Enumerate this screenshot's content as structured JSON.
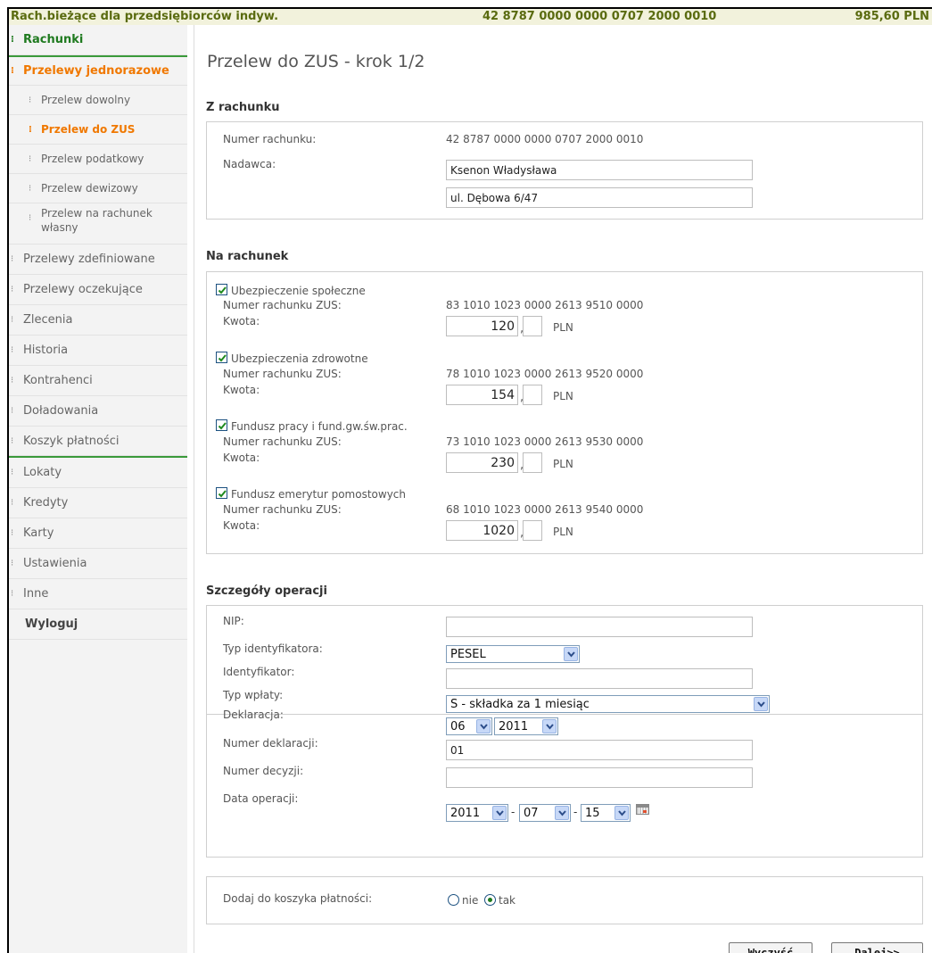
{
  "header": {
    "account_name": "Rach.bieżące dla przedsiębiorców indyw.",
    "account_number": "42 8787 0000 0000 0707 2000 0010",
    "balance": "985,60 PLN"
  },
  "sidebar": {
    "rachunki": "Rachunki",
    "przelewy_jednorazowe": "Przelewy jednorazowe",
    "sub_dowolny": "Przelew dowolny",
    "sub_zus": "Przelew do ZUS",
    "sub_podatkowy": "Przelew podatkowy",
    "sub_dewizowy": "Przelew dewizowy",
    "sub_wlasny": "Przelew na rachunek własny",
    "przelewy_zdefiniowane": "Przelewy zdefiniowane",
    "przelewy_oczekujace": "Przelewy oczekujące",
    "zlecenia": "Zlecenia",
    "historia": "Historia",
    "kontrahenci": "Kontrahenci",
    "doladowania": "Doładowania",
    "koszyk": "Koszyk płatności",
    "lokaty": "Lokaty",
    "kredyty": "Kredyty",
    "karty": "Karty",
    "ustawienia": "Ustawienia",
    "inne": "Inne",
    "wyloguj": "Wyloguj"
  },
  "page": {
    "title": "Przelew do ZUS - krok 1/2"
  },
  "z_rachunku": {
    "heading": "Z rachunku",
    "numer_label": "Numer rachunku:",
    "numer_value": "42 8787 0000 0000 0707 2000 0010",
    "nadawca_label": "Nadawca:",
    "nadawca_line1": "Ksenon Władysława",
    "nadawca_line2": "ul. Dębowa 6/47"
  },
  "na_rachunek": {
    "heading": "Na rachunek",
    "numer_label": "Numer rachunku ZUS:",
    "kwota_label": "Kwota:",
    "currency": "PLN",
    "items": [
      {
        "name": "Ubezpieczenie społeczne",
        "checked": true,
        "account": "83 1010 1023 0000 2613 9510 0000",
        "amount": "120",
        "grosze": ""
      },
      {
        "name": "Ubezpieczenia zdrowotne",
        "checked": true,
        "account": "78 1010 1023 0000 2613 9520 0000",
        "amount": "154",
        "grosze": ""
      },
      {
        "name": "Fundusz pracy i fund.gw.św.prac.",
        "checked": true,
        "account": "73 1010 1023 0000 2613 9530 0000",
        "amount": "230",
        "grosze": ""
      },
      {
        "name": "Fundusz emerytur pomostowych",
        "checked": true,
        "account": "68 1010 1023 0000 2613 9540 0000",
        "amount": "1020",
        "grosze": ""
      }
    ]
  },
  "szczegoly": {
    "heading": "Szczegóły operacji",
    "nip_label": "NIP:",
    "nip_value": "",
    "typ_id_label": "Typ identyfikatora:",
    "typ_id_value": "PESEL",
    "identyfikator_label": "Identyfikator:",
    "identyfikator_value": "",
    "typ_wplaty_label": "Typ wpłaty:",
    "typ_wplaty_value": "S - składka za 1 miesiąc",
    "deklaracja_label": "Deklaracja:",
    "deklaracja_month": "06",
    "deklaracja_year": "2011",
    "nr_deklaracji_label": "Numer deklaracji:",
    "nr_deklaracji_value": "01",
    "nr_decyzji_label": "Numer decyzji:",
    "nr_decyzji_value": "",
    "data_label": "Data operacji:",
    "data_year": "2011",
    "data_month": "07",
    "data_day": "15",
    "sep": "-"
  },
  "koszyk": {
    "label": "Dodaj do koszyka płatności:",
    "opt_nie": "nie",
    "opt_tak": "tak",
    "selected": "tak"
  },
  "buttons": {
    "clear": "Wyczyść",
    "next": "Dalej>>"
  }
}
